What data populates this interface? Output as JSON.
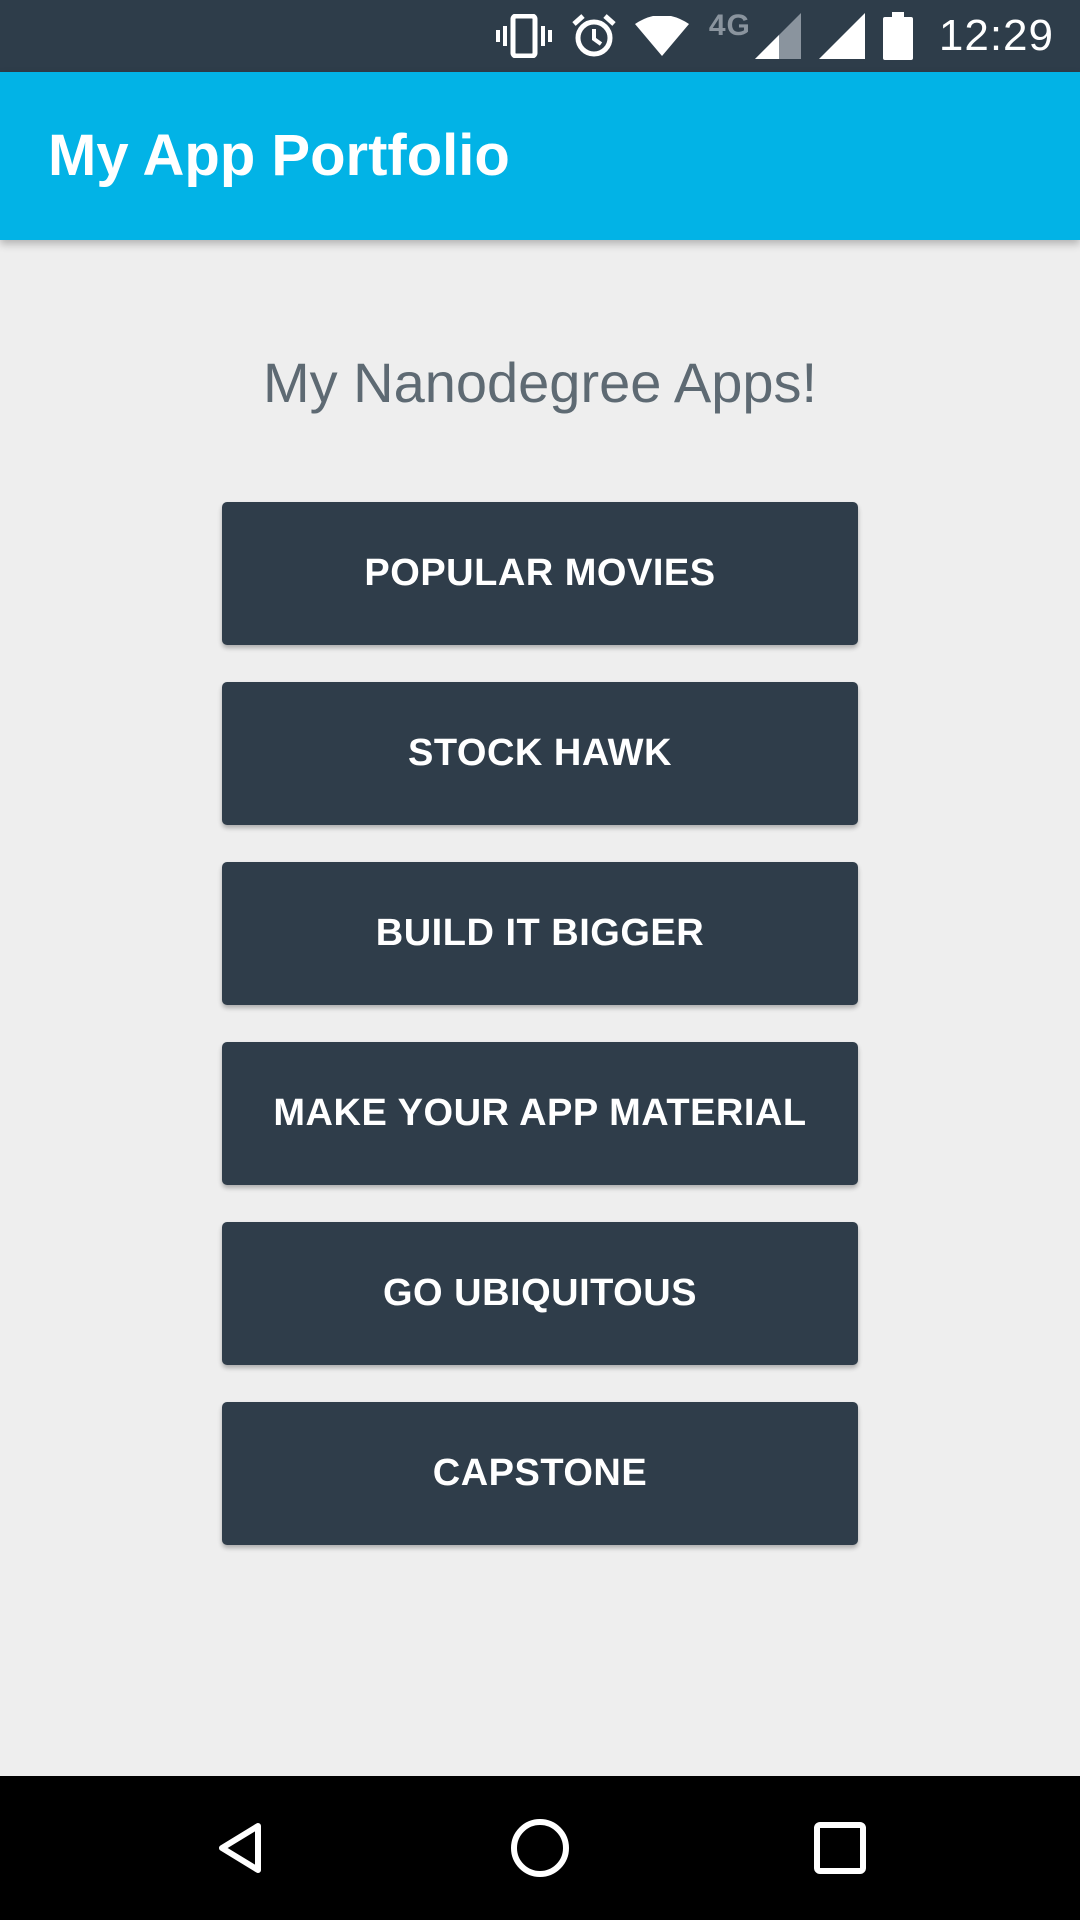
{
  "status_bar": {
    "icons": [
      "vibrate-icon",
      "alarm-icon",
      "wifi-icon",
      "cell-signal-icon",
      "signal-icon",
      "battery-icon"
    ],
    "network_label": "4G",
    "time": "12:29"
  },
  "app_bar": {
    "title": "My App Portfolio",
    "color": "#02b3e6"
  },
  "main": {
    "headline": "My Nanodegree Apps!",
    "buttons": [
      {
        "label": "POPULAR MOVIES"
      },
      {
        "label": "STOCK HAWK"
      },
      {
        "label": "BUILD IT BIGGER"
      },
      {
        "label": "MAKE YOUR APP MATERIAL"
      },
      {
        "label": "GO UBIQUITOUS"
      },
      {
        "label": "CAPSTONE"
      }
    ],
    "button_color": "#2f3d4a"
  },
  "nav_bar": {
    "icons": [
      "back-icon",
      "home-icon",
      "recents-icon"
    ]
  }
}
